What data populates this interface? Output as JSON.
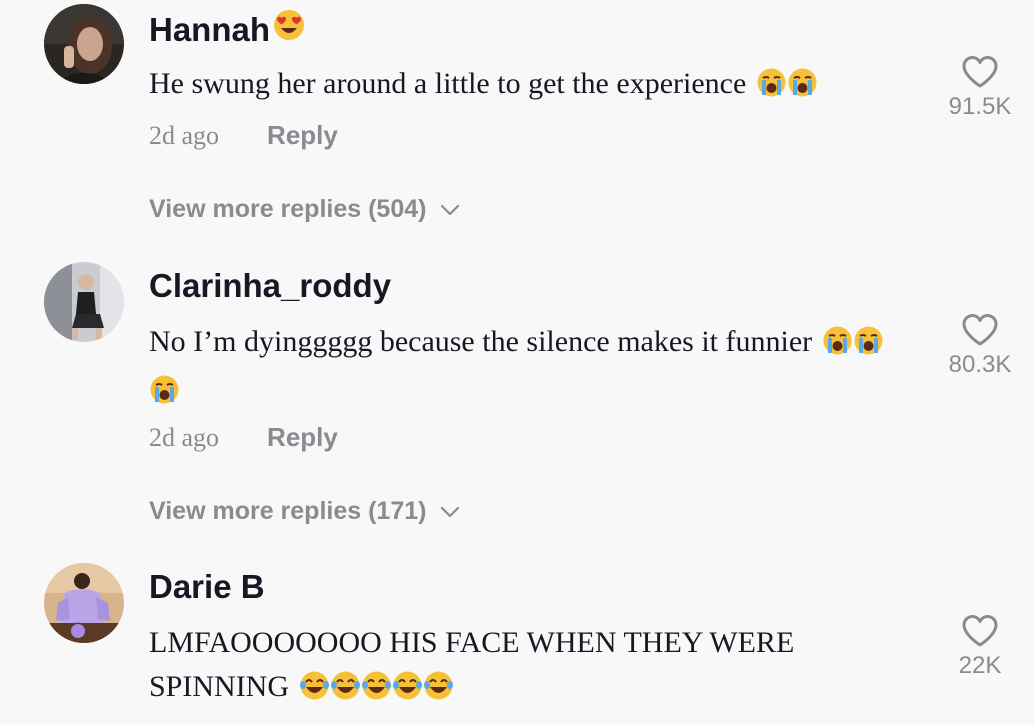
{
  "comments": [
    {
      "username": "Hannah",
      "username_emoji": "heart-eyes-emoji",
      "text": "He swung her around a little to get the experience",
      "text_emojis": [
        "crying-face-emoji",
        "crying-face-emoji"
      ],
      "time": "2d ago",
      "reply_label": "Reply",
      "likes": "91.5K",
      "view_more": "View more replies (504)"
    },
    {
      "username": "Clarinha_roddy",
      "text": "No I’m dyinggggg because the silence makes it funnier",
      "text_emojis": [
        "crying-face-emoji",
        "crying-face-emoji",
        "crying-face-emoji"
      ],
      "time": "2d ago",
      "reply_label": "Reply",
      "likes": "80.3K",
      "view_more": "View more replies (171)"
    },
    {
      "username": "Darie B",
      "text": "LMFAOOOOOOO HIS FACE WHEN THEY WERE SPINNING",
      "text_emojis": [
        "tears-of-joy-emoji",
        "tears-of-joy-emoji",
        "tears-of-joy-emoji",
        "tears-of-joy-emoji",
        "tears-of-joy-emoji"
      ],
      "likes": "22K"
    }
  ],
  "icons": {
    "like": "heart-outline-icon",
    "expand": "chevron-down-icon"
  },
  "colors": {
    "background": "#f8f8f8",
    "primary_text": "#161823",
    "secondary_text": "#8a8b91"
  }
}
